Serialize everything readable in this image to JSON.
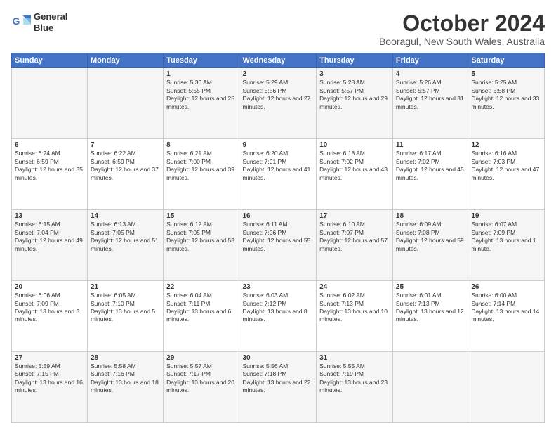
{
  "logo": {
    "line1": "General",
    "line2": "Blue"
  },
  "header": {
    "month": "October 2024",
    "location": "Booragul, New South Wales, Australia"
  },
  "weekdays": [
    "Sunday",
    "Monday",
    "Tuesday",
    "Wednesday",
    "Thursday",
    "Friday",
    "Saturday"
  ],
  "weeks": [
    [
      {
        "day": "",
        "sunrise": "",
        "sunset": "",
        "daylight": ""
      },
      {
        "day": "",
        "sunrise": "",
        "sunset": "",
        "daylight": ""
      },
      {
        "day": "1",
        "sunrise": "Sunrise: 5:30 AM",
        "sunset": "Sunset: 5:55 PM",
        "daylight": "Daylight: 12 hours and 25 minutes."
      },
      {
        "day": "2",
        "sunrise": "Sunrise: 5:29 AM",
        "sunset": "Sunset: 5:56 PM",
        "daylight": "Daylight: 12 hours and 27 minutes."
      },
      {
        "day": "3",
        "sunrise": "Sunrise: 5:28 AM",
        "sunset": "Sunset: 5:57 PM",
        "daylight": "Daylight: 12 hours and 29 minutes."
      },
      {
        "day": "4",
        "sunrise": "Sunrise: 5:26 AM",
        "sunset": "Sunset: 5:57 PM",
        "daylight": "Daylight: 12 hours and 31 minutes."
      },
      {
        "day": "5",
        "sunrise": "Sunrise: 5:25 AM",
        "sunset": "Sunset: 5:58 PM",
        "daylight": "Daylight: 12 hours and 33 minutes."
      }
    ],
    [
      {
        "day": "6",
        "sunrise": "Sunrise: 6:24 AM",
        "sunset": "Sunset: 6:59 PM",
        "daylight": "Daylight: 12 hours and 35 minutes."
      },
      {
        "day": "7",
        "sunrise": "Sunrise: 6:22 AM",
        "sunset": "Sunset: 6:59 PM",
        "daylight": "Daylight: 12 hours and 37 minutes."
      },
      {
        "day": "8",
        "sunrise": "Sunrise: 6:21 AM",
        "sunset": "Sunset: 7:00 PM",
        "daylight": "Daylight: 12 hours and 39 minutes."
      },
      {
        "day": "9",
        "sunrise": "Sunrise: 6:20 AM",
        "sunset": "Sunset: 7:01 PM",
        "daylight": "Daylight: 12 hours and 41 minutes."
      },
      {
        "day": "10",
        "sunrise": "Sunrise: 6:18 AM",
        "sunset": "Sunset: 7:02 PM",
        "daylight": "Daylight: 12 hours and 43 minutes."
      },
      {
        "day": "11",
        "sunrise": "Sunrise: 6:17 AM",
        "sunset": "Sunset: 7:02 PM",
        "daylight": "Daylight: 12 hours and 45 minutes."
      },
      {
        "day": "12",
        "sunrise": "Sunrise: 6:16 AM",
        "sunset": "Sunset: 7:03 PM",
        "daylight": "Daylight: 12 hours and 47 minutes."
      }
    ],
    [
      {
        "day": "13",
        "sunrise": "Sunrise: 6:15 AM",
        "sunset": "Sunset: 7:04 PM",
        "daylight": "Daylight: 12 hours and 49 minutes."
      },
      {
        "day": "14",
        "sunrise": "Sunrise: 6:13 AM",
        "sunset": "Sunset: 7:05 PM",
        "daylight": "Daylight: 12 hours and 51 minutes."
      },
      {
        "day": "15",
        "sunrise": "Sunrise: 6:12 AM",
        "sunset": "Sunset: 7:05 PM",
        "daylight": "Daylight: 12 hours and 53 minutes."
      },
      {
        "day": "16",
        "sunrise": "Sunrise: 6:11 AM",
        "sunset": "Sunset: 7:06 PM",
        "daylight": "Daylight: 12 hours and 55 minutes."
      },
      {
        "day": "17",
        "sunrise": "Sunrise: 6:10 AM",
        "sunset": "Sunset: 7:07 PM",
        "daylight": "Daylight: 12 hours and 57 minutes."
      },
      {
        "day": "18",
        "sunrise": "Sunrise: 6:09 AM",
        "sunset": "Sunset: 7:08 PM",
        "daylight": "Daylight: 12 hours and 59 minutes."
      },
      {
        "day": "19",
        "sunrise": "Sunrise: 6:07 AM",
        "sunset": "Sunset: 7:09 PM",
        "daylight": "Daylight: 13 hours and 1 minute."
      }
    ],
    [
      {
        "day": "20",
        "sunrise": "Sunrise: 6:06 AM",
        "sunset": "Sunset: 7:09 PM",
        "daylight": "Daylight: 13 hours and 3 minutes."
      },
      {
        "day": "21",
        "sunrise": "Sunrise: 6:05 AM",
        "sunset": "Sunset: 7:10 PM",
        "daylight": "Daylight: 13 hours and 5 minutes."
      },
      {
        "day": "22",
        "sunrise": "Sunrise: 6:04 AM",
        "sunset": "Sunset: 7:11 PM",
        "daylight": "Daylight: 13 hours and 6 minutes."
      },
      {
        "day": "23",
        "sunrise": "Sunrise: 6:03 AM",
        "sunset": "Sunset: 7:12 PM",
        "daylight": "Daylight: 13 hours and 8 minutes."
      },
      {
        "day": "24",
        "sunrise": "Sunrise: 6:02 AM",
        "sunset": "Sunset: 7:13 PM",
        "daylight": "Daylight: 13 hours and 10 minutes."
      },
      {
        "day": "25",
        "sunrise": "Sunrise: 6:01 AM",
        "sunset": "Sunset: 7:13 PM",
        "daylight": "Daylight: 13 hours and 12 minutes."
      },
      {
        "day": "26",
        "sunrise": "Sunrise: 6:00 AM",
        "sunset": "Sunset: 7:14 PM",
        "daylight": "Daylight: 13 hours and 14 minutes."
      }
    ],
    [
      {
        "day": "27",
        "sunrise": "Sunrise: 5:59 AM",
        "sunset": "Sunset: 7:15 PM",
        "daylight": "Daylight: 13 hours and 16 minutes."
      },
      {
        "day": "28",
        "sunrise": "Sunrise: 5:58 AM",
        "sunset": "Sunset: 7:16 PM",
        "daylight": "Daylight: 13 hours and 18 minutes."
      },
      {
        "day": "29",
        "sunrise": "Sunrise: 5:57 AM",
        "sunset": "Sunset: 7:17 PM",
        "daylight": "Daylight: 13 hours and 20 minutes."
      },
      {
        "day": "30",
        "sunrise": "Sunrise: 5:56 AM",
        "sunset": "Sunset: 7:18 PM",
        "daylight": "Daylight: 13 hours and 22 minutes."
      },
      {
        "day": "31",
        "sunrise": "Sunrise: 5:55 AM",
        "sunset": "Sunset: 7:19 PM",
        "daylight": "Daylight: 13 hours and 23 minutes."
      },
      {
        "day": "",
        "sunrise": "",
        "sunset": "",
        "daylight": ""
      },
      {
        "day": "",
        "sunrise": "",
        "sunset": "",
        "daylight": ""
      }
    ]
  ]
}
